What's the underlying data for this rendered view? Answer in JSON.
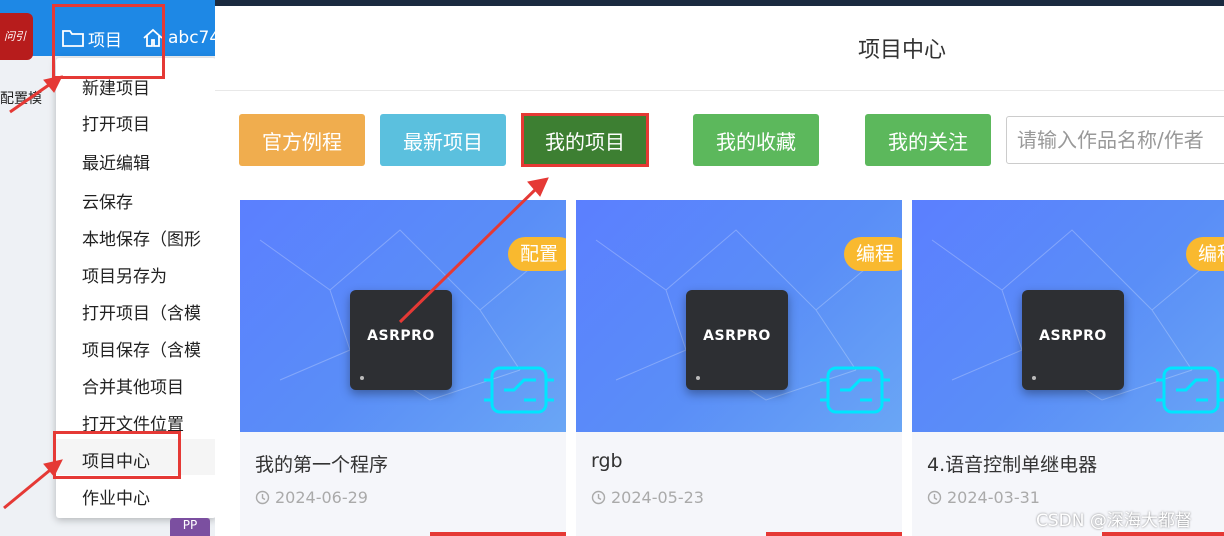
{
  "app": {
    "logo_text": "问引",
    "menu_label": "项目",
    "user_label": "abc74",
    "config_label": "配置模"
  },
  "dropdown": {
    "items": [
      "新建项目",
      "打开项目",
      "最近编辑",
      "云保存",
      "本地保存（图形",
      "项目另存为",
      "打开项目（含模",
      "项目保存（含模",
      "合并其他项目",
      "打开文件位置",
      "项目中心",
      "作业中心"
    ],
    "active_item": "项目中心"
  },
  "side_badge": "PP",
  "modal": {
    "title": "项目中心",
    "tabs": [
      {
        "label": "官方例程",
        "color": "#f0ad4e"
      },
      {
        "label": "最新项目",
        "color": "#5bc0de"
      },
      {
        "label": "我的项目",
        "color": "#3d7f32",
        "selected": true
      },
      {
        "label": "我的收藏",
        "color": "#5cb85c"
      },
      {
        "label": "我的关注",
        "color": "#5cb85c"
      }
    ],
    "search_placeholder": "请输入作品名称/作者"
  },
  "cards": [
    {
      "tag": "配置",
      "chip": "ASRPRO",
      "title": "我的第一个程序",
      "date": "2024-06-29"
    },
    {
      "tag": "编程",
      "chip": "ASRPRO",
      "title": "rgb",
      "date": "2024-05-23"
    },
    {
      "tag": "编程",
      "chip": "ASRPRO",
      "title": "4.语音控制单继电器",
      "date": "2024-03-31"
    }
  ],
  "watermark": "CSDN @深海大都督",
  "colors": {
    "annotation": "#e53935",
    "topbar": "#1e88e5",
    "tag": "#f9b92f"
  }
}
